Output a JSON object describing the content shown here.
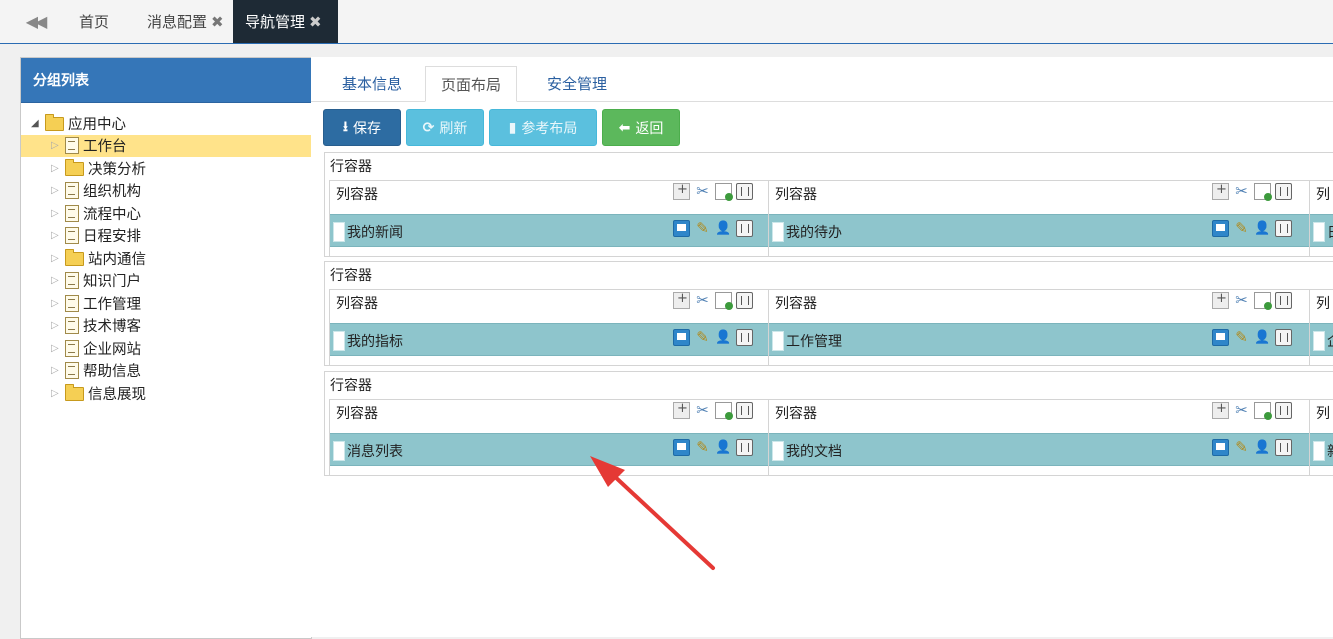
{
  "tabbar": {
    "tabs": [
      {
        "label": "首页",
        "closable": false,
        "active": false
      },
      {
        "label": "消息配置",
        "closable": true,
        "active": false
      },
      {
        "label": "导航管理",
        "closable": true,
        "active": true
      }
    ],
    "close_glyph": "✖"
  },
  "left_panel": {
    "title": "分组列表",
    "tree": {
      "root": {
        "label": "应用中心",
        "icon": "folder-open-icon",
        "expanded": true
      },
      "items": [
        {
          "label": "工作台",
          "icon": "document-icon",
          "selected": true
        },
        {
          "label": "决策分析",
          "icon": "folder-icon",
          "selected": false
        },
        {
          "label": "组织机构",
          "icon": "document-icon",
          "selected": false
        },
        {
          "label": "流程中心",
          "icon": "document-icon",
          "selected": false
        },
        {
          "label": "日程安排",
          "icon": "document-icon",
          "selected": false
        },
        {
          "label": "站内通信",
          "icon": "folder-icon",
          "selected": false
        },
        {
          "label": "知识门户",
          "icon": "document-icon",
          "selected": false
        },
        {
          "label": "工作管理",
          "icon": "document-icon",
          "selected": false
        },
        {
          "label": "技术博客",
          "icon": "document-icon",
          "selected": false
        },
        {
          "label": "企业网站",
          "icon": "document-icon",
          "selected": false
        },
        {
          "label": "帮助信息",
          "icon": "document-icon",
          "selected": false
        },
        {
          "label": "信息展现",
          "icon": "folder-icon",
          "selected": false
        }
      ]
    }
  },
  "subtabs": [
    {
      "label": "基本信息",
      "active": false
    },
    {
      "label": "页面布局",
      "active": true
    },
    {
      "label": "安全管理",
      "active": false
    }
  ],
  "toolbar": {
    "save": "保存",
    "refresh": "刷新",
    "reference_layout": "参考布局",
    "back": "返回"
  },
  "layout": {
    "row_label": "行容器",
    "col_label": "列容器",
    "rows": [
      {
        "widgets": [
          "我的新闻",
          "我的待办"
        ],
        "third_col_label": "列",
        "third_widget_fragment": "日"
      },
      {
        "widgets": [
          "我的指标",
          "工作管理"
        ],
        "third_col_label": "列",
        "third_widget_fragment": "企"
      },
      {
        "widgets": [
          "消息列表",
          "我的文档"
        ],
        "third_col_label": "列",
        "third_widget_fragment": "新"
      }
    ]
  },
  "colors": {
    "header_blue": "#3576b8",
    "active_tab_bg": "#1e2a35",
    "widget_teal": "#8ec5cc",
    "selected_yellow": "#ffe38a",
    "annotation_arrow": "#e53935",
    "btn_primary": "#2d6ca2",
    "btn_info": "#5bc0de",
    "btn_success": "#5cb85c"
  }
}
